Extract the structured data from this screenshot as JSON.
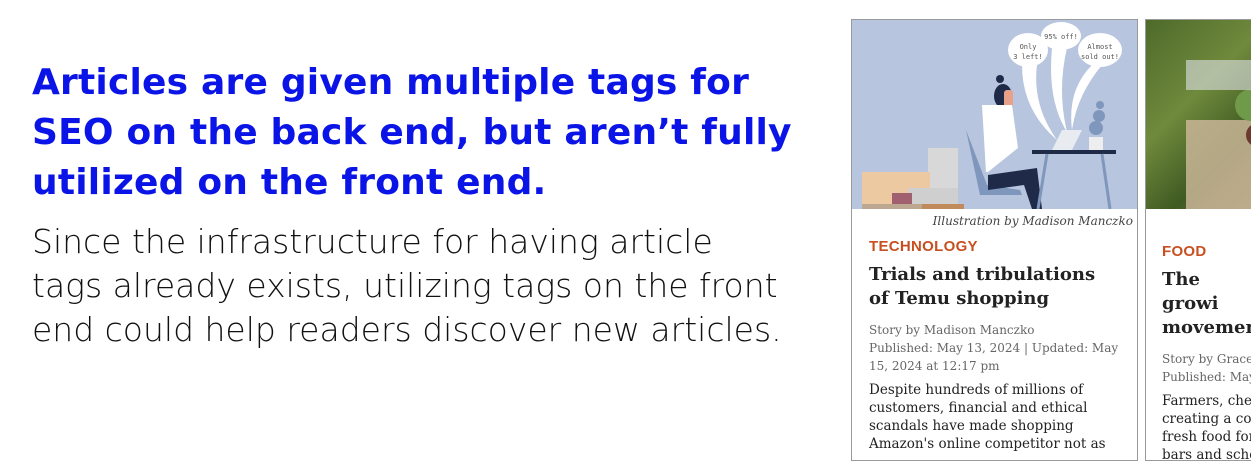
{
  "headline": "Articles are given multiple tags for SEO on the back end, but aren’t fully utilized on the front end.",
  "body": "Since the infrastructure for having article tags already exists, utilizing tags on the front end could help readers discover new articles.",
  "cards": [
    {
      "bubbles": [
        "Only 3 left!",
        "95% off!",
        "Almost sold out!"
      ],
      "caption": "Illustration by Madison Manczko",
      "category": "TECHNOLOGY",
      "title": "Trials and tribulations of Temu shopping",
      "byline": "Story by Madison Manczko",
      "dates": "Published: May 13, 2024 | Updated: May 15, 2024 at 12:17 pm",
      "summary": "Despite hundreds of millions of customers, financial and ethical scandals have made shopping Amazon's online competitor not as"
    },
    {
      "category": "FOOD",
      "title": "The growi movemen",
      "byline": "Story by Grace",
      "dates": "Published: May",
      "summary": "Farmers, chef creating a con fresh food for bars and scho"
    }
  ],
  "colors": {
    "headline": "#0a14e6",
    "category": "#c85020",
    "illustration_bg": "#b8c5de"
  }
}
